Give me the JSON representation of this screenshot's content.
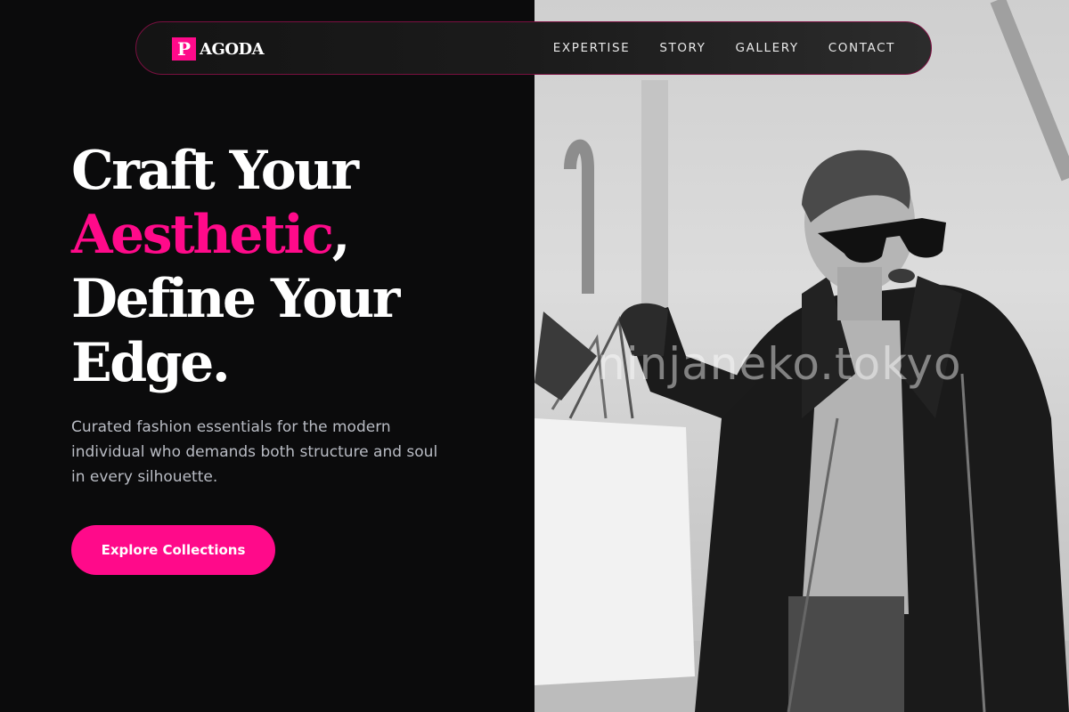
{
  "brand": {
    "mark": "P",
    "name": "AGODA"
  },
  "nav": {
    "links": [
      "EXPERTISE",
      "STORY",
      "GALLERY",
      "CONTACT"
    ]
  },
  "hero": {
    "headline": {
      "line1": "Craft Your",
      "accent": "Aesthetic",
      "comma": ",",
      "line3": "Define Your",
      "line4": "Edge."
    },
    "subtext": "Curated fashion essentials for the modern individual who demands both structure and soul in every silhouette.",
    "cta_label": "Explore Collections",
    "image": {
      "description": "Black and white photo of a woman in sunglasses and a dark coat holding shopping bags",
      "watermark": "ninjaneko.tokyo"
    }
  },
  "colors": {
    "accent": "#ff0a8a",
    "background": "#0b0b0c",
    "text": "#ffffff",
    "muted": "#b9bcc4"
  }
}
